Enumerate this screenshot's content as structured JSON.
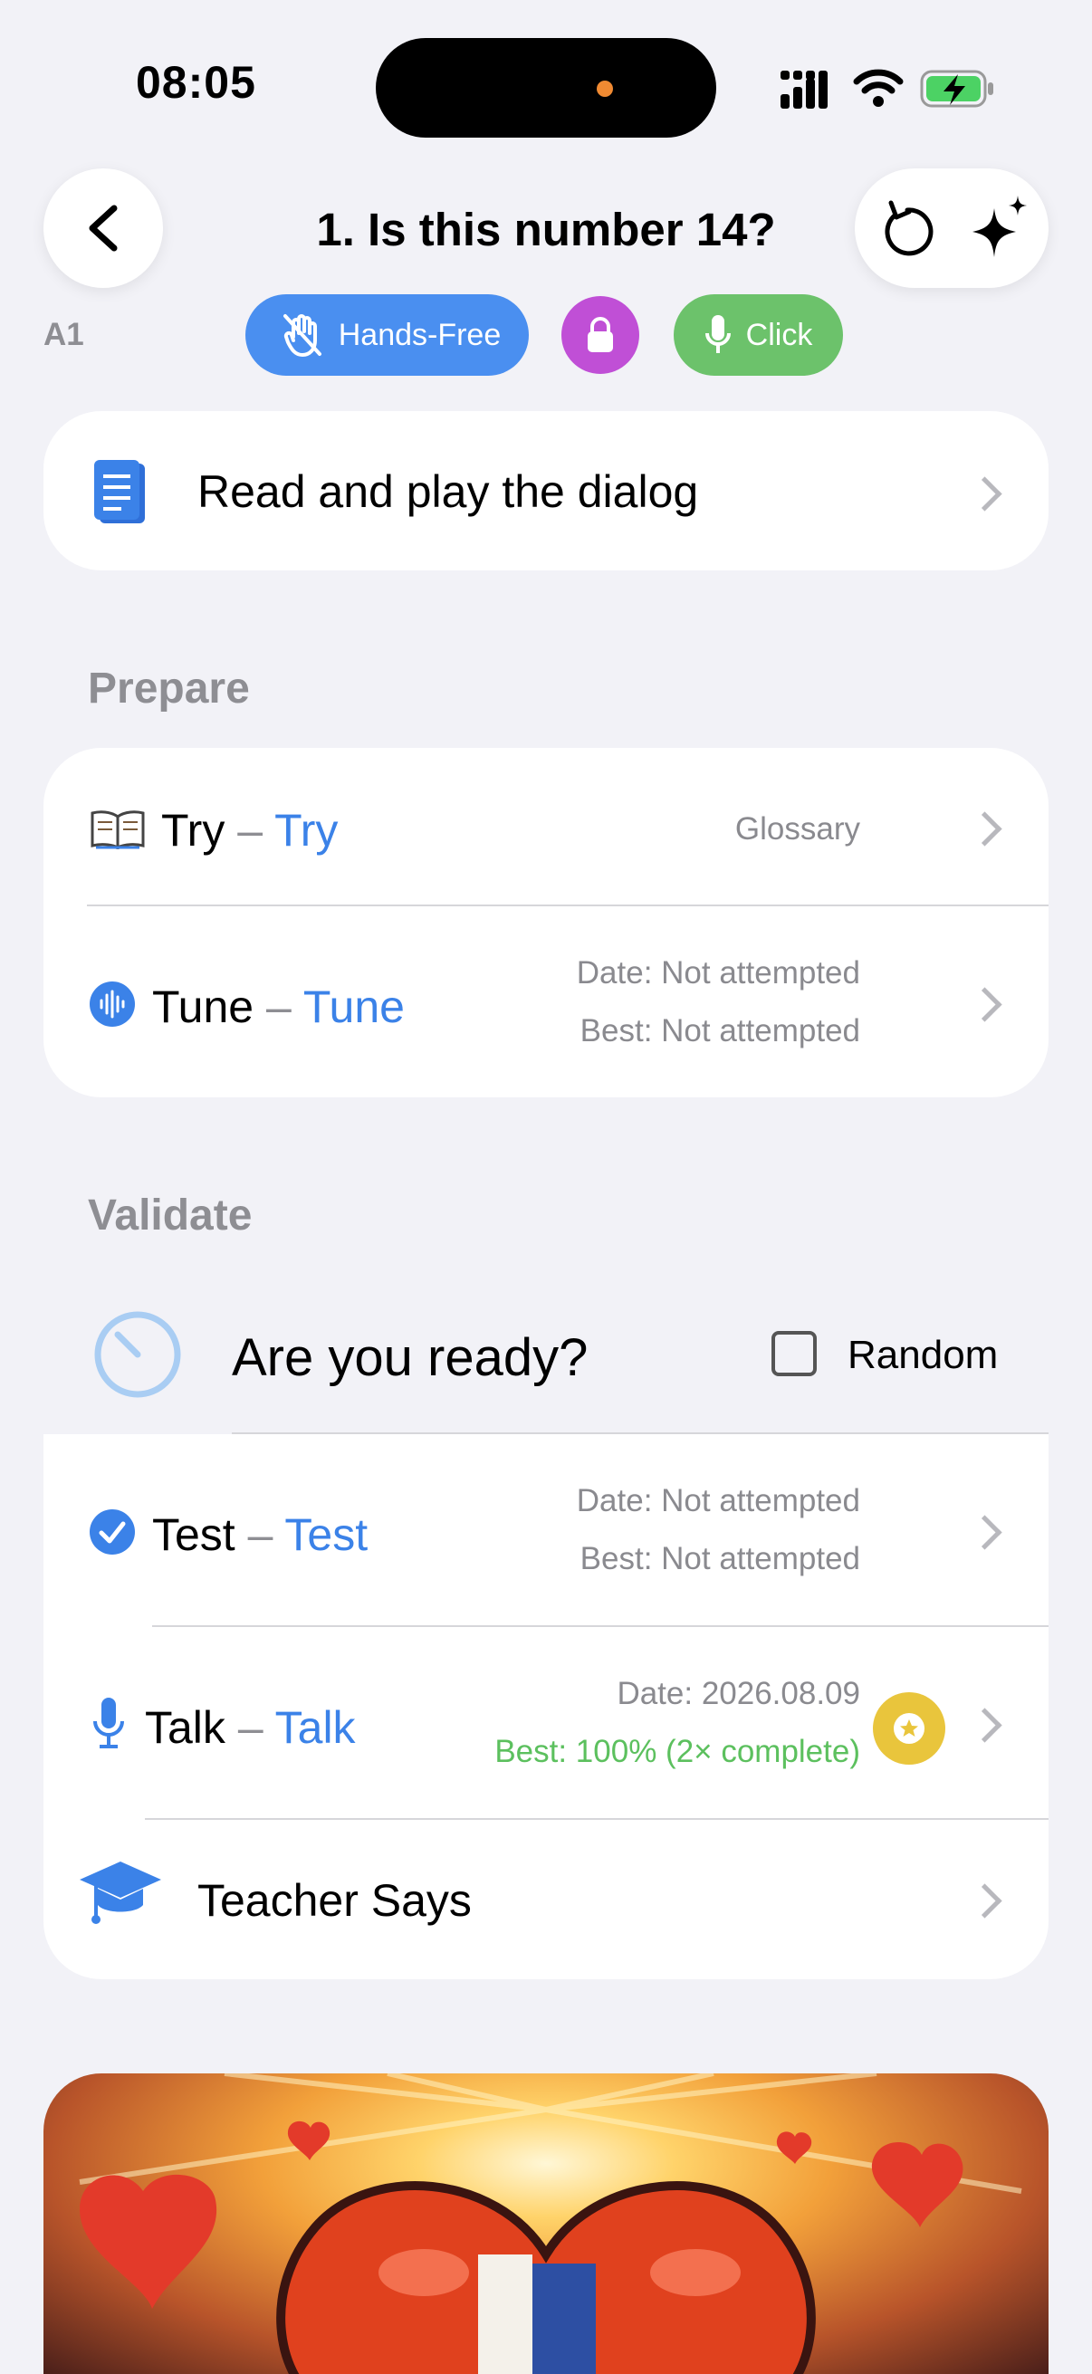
{
  "status": {
    "time": "08:05"
  },
  "header": {
    "title": "1. Is this number 14?",
    "level": "A1",
    "modes": {
      "hands_free": "Hands-Free",
      "click": "Click"
    }
  },
  "dialog": {
    "label": "Read and play the dialog"
  },
  "prepare": {
    "heading": "Prepare",
    "try": {
      "name": "Try",
      "sep": "–",
      "alt": "Try",
      "meta": "Glossary"
    },
    "tune": {
      "name": "Tune",
      "sep": "–",
      "alt": "Tune",
      "date": "Date: Not attempted",
      "best": "Best: Not attempted"
    }
  },
  "validate": {
    "heading": "Validate",
    "ready": "Are you ready?",
    "random": "Random",
    "test": {
      "name": "Test",
      "sep": "–",
      "alt": "Test",
      "date": "Date: Not attempted",
      "best": "Best: Not attempted"
    },
    "talk": {
      "name": "Talk",
      "sep": "–",
      "alt": "Talk",
      "date": "Date: 2026.08.09",
      "best": "Best: 100% (2× complete)"
    },
    "teacher": {
      "label": "Teacher Says"
    }
  },
  "colors": {
    "accent": "#3b82e8",
    "handsfree": "#4a8ff0",
    "lock": "#c04fd6",
    "click": "#6cc26b",
    "success": "#5cc05e",
    "star": "#e9c53c"
  },
  "icons": [
    "back-icon",
    "refresh-icon",
    "sparkles-icon",
    "hand-off-icon",
    "lock-icon",
    "mic-icon",
    "document-icon",
    "book-icon",
    "waveform-icon",
    "timer-icon",
    "checkmark-icon",
    "graduation-cap-icon",
    "star-badge-icon",
    "chevron-right-icon"
  ]
}
